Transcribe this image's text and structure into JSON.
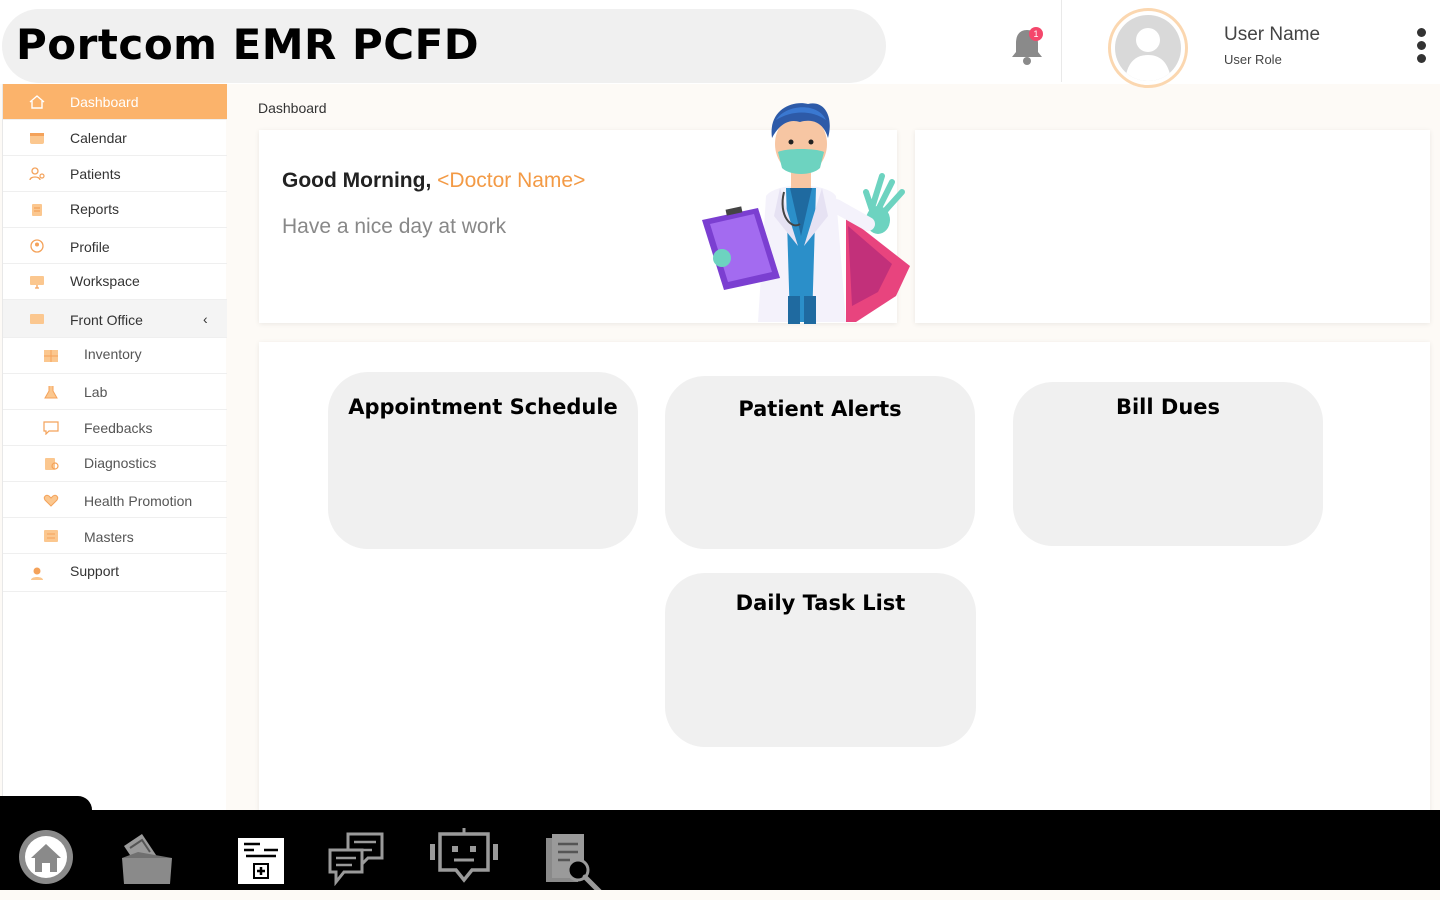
{
  "header": {
    "app_title": "Portcom EMR PCFD",
    "notification_count": "1",
    "user_name": "User Name",
    "user_role": "User Role"
  },
  "sidebar": {
    "items": [
      {
        "label": "Dashboard",
        "icon": "home-icon",
        "active": true
      },
      {
        "label": "Calendar",
        "icon": "calendar-icon"
      },
      {
        "label": "Patients",
        "icon": "patients-icon"
      },
      {
        "label": "Reports",
        "icon": "reports-icon"
      },
      {
        "label": "Profile",
        "icon": "profile-icon"
      },
      {
        "label": "Workspace",
        "icon": "monitor-icon"
      },
      {
        "label": "Front Office",
        "icon": "front-office-icon",
        "expanded": true
      },
      {
        "label": "Inventory",
        "icon": "inventory-icon"
      },
      {
        "label": "Lab",
        "icon": "lab-icon"
      },
      {
        "label": "Feedbacks",
        "icon": "feedback-icon"
      },
      {
        "label": "Diagnostics",
        "icon": "diagnostics-icon"
      },
      {
        "label": "Health Promotion",
        "icon": "health-promotion-icon"
      },
      {
        "label": "Masters",
        "icon": "masters-icon"
      },
      {
        "label": "Support",
        "icon": "support-icon"
      }
    ]
  },
  "main": {
    "breadcrumb": "Dashboard",
    "greeting_prefix": "Good Morning,",
    "doctor_name": "<Doctor Name>",
    "greeting_sub": "Have a nice day at work",
    "tiles": [
      {
        "title": "Appointment Schedule"
      },
      {
        "title": "Patient Alerts"
      },
      {
        "title": "Bill Dues"
      },
      {
        "title": "Daily Task List"
      }
    ]
  },
  "dock": {
    "icons": [
      "home-icon",
      "documents-icon",
      "medical-record-icon",
      "chat-icon",
      "bot-icon",
      "document-search-icon"
    ]
  },
  "colors": {
    "accent": "#fbb36b",
    "doctor_name": "#f39a45",
    "badge": "#f4476b",
    "tile_bg": "#f0f0f0"
  }
}
